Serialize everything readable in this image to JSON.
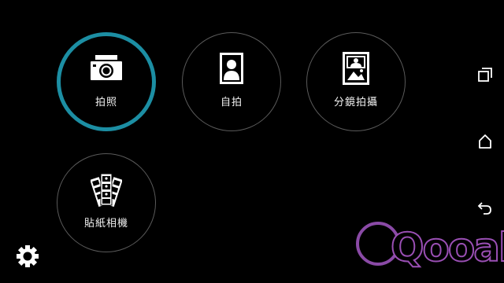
{
  "modes": [
    {
      "id": "photo",
      "label": "拍照",
      "icon": "camera-icon",
      "selected": true
    },
    {
      "id": "selfie",
      "label": "自拍",
      "icon": "portrait-icon",
      "selected": false
    },
    {
      "id": "split",
      "label": "分鏡拍攝",
      "icon": "split-frame-icon",
      "selected": false
    },
    {
      "id": "sticker",
      "label": "貼紙相機",
      "icon": "photo-strips-icon",
      "selected": false
    }
  ],
  "nav": [
    "recent-apps-icon",
    "home-icon",
    "back-icon"
  ],
  "settings_icon": "gear-icon",
  "watermark": {
    "text": "Qooah"
  },
  "colors": {
    "accent": "#1c8ea3",
    "ring": "#5a5a5a",
    "background": "#000000",
    "watermark": "#9a4fb4"
  }
}
